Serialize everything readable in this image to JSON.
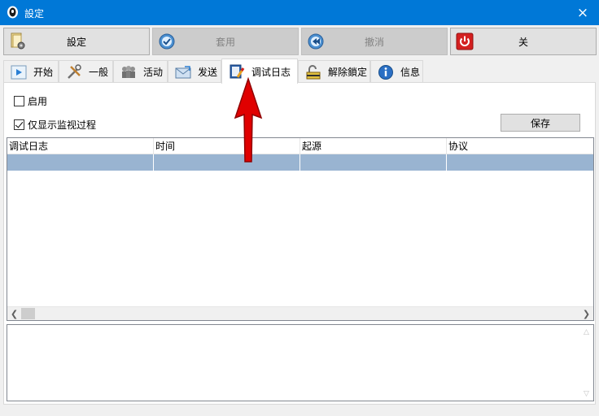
{
  "window": {
    "title": "設定",
    "close_icon": "×"
  },
  "toolbar": {
    "settings_label": "設定",
    "apply_label": "套用",
    "cancel_label": "撤消",
    "close_label": "关"
  },
  "tabs": [
    {
      "label": "开始",
      "icon": "play-icon"
    },
    {
      "label": "一般",
      "icon": "tools-icon"
    },
    {
      "label": "活动",
      "icon": "people-icon"
    },
    {
      "label": "发送",
      "icon": "envelope-icon"
    },
    {
      "label": "调试日志",
      "icon": "notepad-pencil-icon",
      "active": true
    },
    {
      "label": "解除鎖定",
      "icon": "padlock-icon"
    },
    {
      "label": "信息",
      "icon": "info-icon"
    }
  ],
  "debug": {
    "enable_label": "启用",
    "enable_checked": false,
    "monitor_only_label": "仅显示监视过程",
    "monitor_only_checked": true,
    "save_label": "保存",
    "columns": [
      "调试日志",
      "时间",
      "起源",
      "协议"
    ]
  },
  "colors": {
    "titlebar": "#0078d7",
    "selected_row": "#99b4d1",
    "arrow": "#e00000"
  }
}
